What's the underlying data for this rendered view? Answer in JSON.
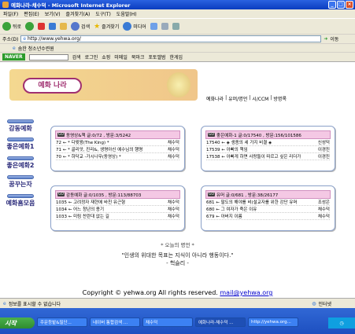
{
  "window": {
    "title": "예화나라-채수덕 - Microsoft Internet Explorer"
  },
  "menu": [
    "파일(F)",
    "편집(E)",
    "보기(V)",
    "즐겨찾기(A)",
    "도구(T)",
    "도움말(H)"
  ],
  "toolbar": {
    "back": "뒤로",
    "search": "검색",
    "favorites": "즐겨찾기",
    "media": "미디어"
  },
  "address": {
    "label": "주소(D)",
    "url": "http://www.yehwa.org/",
    "go": "이동"
  },
  "links": {
    "label": "숨한 청소년수련원"
  },
  "naver": {
    "logo": "NAVER",
    "search": "검색",
    "items": [
      "로그인",
      "쇼핑",
      "미메일",
      "북마크",
      "포토앨범",
      "한게임"
    ]
  },
  "banner": {
    "title": "예화 나라"
  },
  "topnav": [
    "예화나라",
    "유머/명언",
    "시/CCM",
    "방명록"
  ],
  "leftnav": [
    "감동예화",
    "좋은예화1",
    "좋은예화2",
    "꿈꾸는자",
    "예화홈모음"
  ],
  "panels": [
    {
      "header": "동영상&책  글:0/72 , 방문:3/5242",
      "rows": [
        {
          "title": "72 ← * 다윗왕(The King) *",
          "author": "채수덕"
        },
        {
          "title": "71 ← * 골리앗, 진리&, 생명아신 예수님의 행명",
          "author": "채수덕"
        },
        {
          "title": "70 ← * 하닥교 -가시나무(동영상) *",
          "author": "채수덕"
        }
      ]
    },
    {
      "header": "좋은예화-1  글:0/17540 , 방문:156/101586",
      "rows": [
        {
          "title": "17540 ← ◈ 생종의 세 가지 비결 ◈",
          "author": "신성덕"
        },
        {
          "title": "17539 ← 아빠의 책임",
          "author": "이경진"
        },
        {
          "title": "17538 ← 아빠게 하면 사랑들이 따르고 싶은 리더가",
          "author": "이경진"
        }
      ]
    },
    {
      "header": "감동예화  글:0/1035 , 방문:113/88703",
      "rows": [
        {
          "title": "1035 ← 고려정자 재현에 바친 유근형",
          "author": "채수덕"
        },
        {
          "title": "1034 ← 어느 청년의 용기",
          "author": "채수덕"
        },
        {
          "title": "1033 ← 미림 찬란대 없는 길",
          "author": "채수덕"
        }
      ]
    },
    {
      "header": "유머  글:0/681 , 방문:38/26177",
      "rows": [
        {
          "title": "681 ← 팔도의 해야를 비(설교자를 위한 강단 유머",
          "author": "조성은"
        },
        {
          "title": "680 ← 그 여자가 죽은 이유",
          "author": "채수덕"
        },
        {
          "title": "679 ← 아버지 이름",
          "author": "채수덕"
        }
      ]
    }
  ],
  "motto": {
    "heading": "* 오늘의 명언 *",
    "quote": "\"인생의 위대한 목표는 지식이 아니라 행동이다.\"",
    "author": "- 헉슬리 -"
  },
  "copyright": {
    "text": "Copyright © yehwa.org  All rights reserved.",
    "email": "mail@yehwa.org"
  },
  "status": {
    "text": "정보를 표시할 수 없습니다",
    "zone": "인터넷"
  },
  "taskbar": {
    "start": "시작",
    "tasks": [
      "주문등밭&필단...",
      "네이버 통합검색 ...",
      "채수덕",
      "예화나라-채수덕 ...",
      "http://yehwa.org..."
    ]
  }
}
